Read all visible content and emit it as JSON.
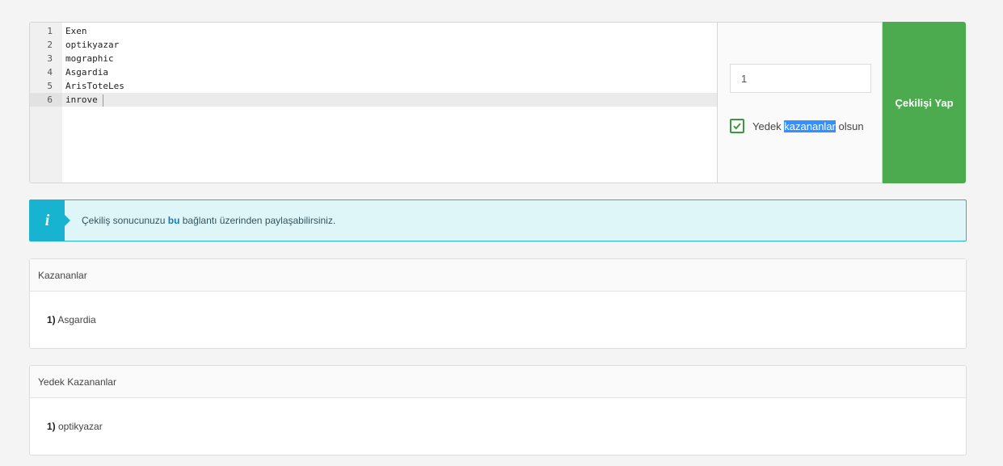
{
  "editor": {
    "lines": [
      {
        "num": "1",
        "text": "Exen"
      },
      {
        "num": "2",
        "text": "optikyazar"
      },
      {
        "num": "3",
        "text": "mographic"
      },
      {
        "num": "4",
        "text": "Asgardia"
      },
      {
        "num": "5",
        "text": "ArisToteLes"
      },
      {
        "num": "6",
        "text": "inrove"
      }
    ],
    "active_line": 6
  },
  "settings": {
    "winner_count": "1",
    "backup_checkbox": {
      "checked": true,
      "label_prefix": "Yedek ",
      "label_selected": "kazananlar",
      "label_suffix": " olsun"
    }
  },
  "draw_button": {
    "label": "Çekilişi Yap",
    "color": "#4cab4f"
  },
  "alert": {
    "icon": "info-icon",
    "text_before": "Çekiliş sonucunuzu ",
    "link": "bu",
    "text_after": " bağlantı üzerinden paylaşabilirsiniz.",
    "color": "#17b3d1"
  },
  "winners": {
    "title": "Kazananlar",
    "items": [
      {
        "rank": "1)",
        "name": " Asgardia"
      }
    ]
  },
  "backup_winners": {
    "title": "Yedek Kazananlar",
    "items": [
      {
        "rank": "1)",
        "name": " optikyazar"
      }
    ]
  }
}
